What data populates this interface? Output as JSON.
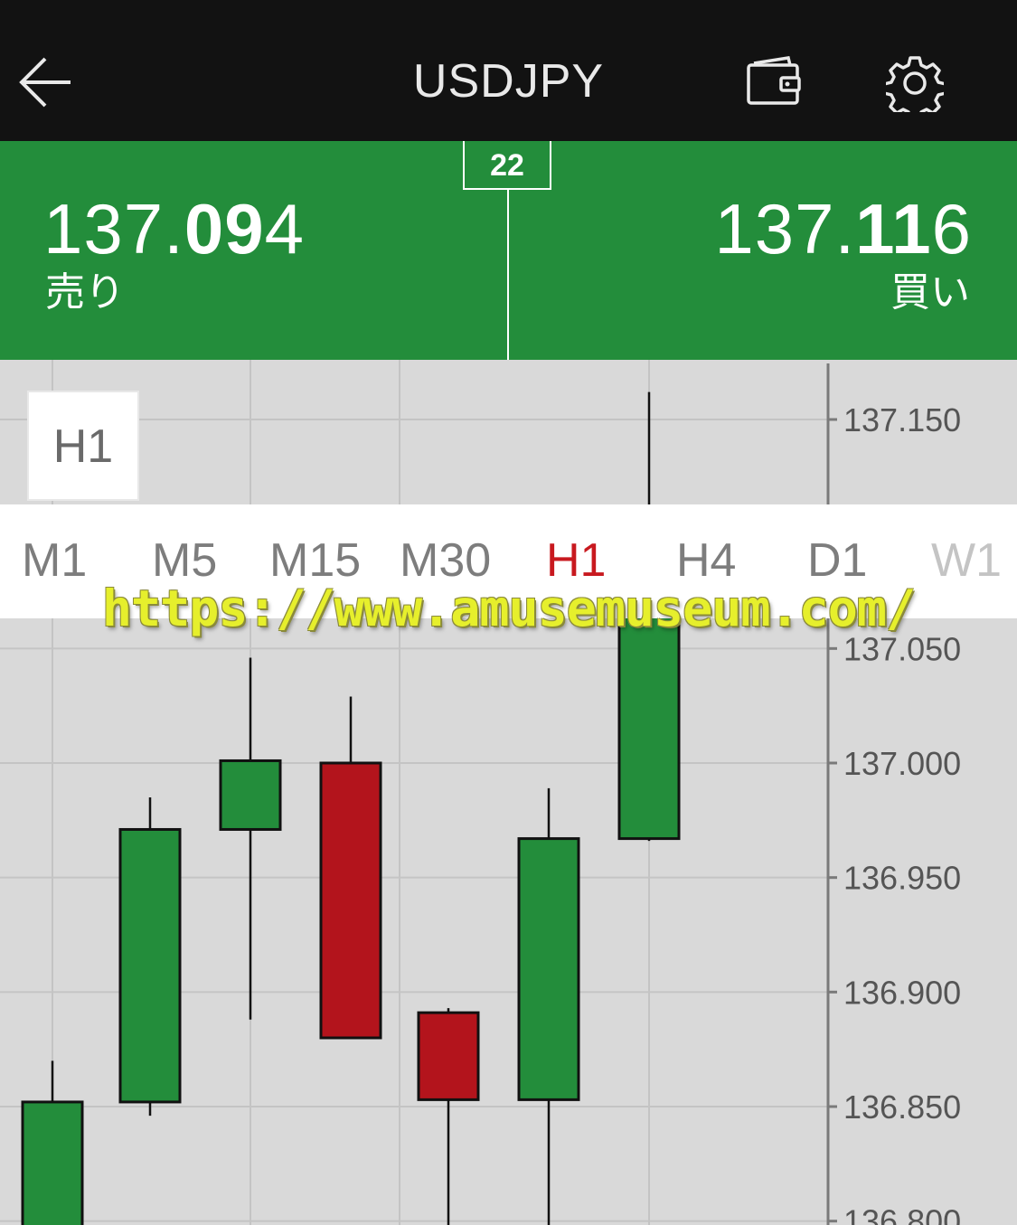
{
  "header": {
    "title": "USDJPY",
    "back_icon": "arrow-left-icon",
    "wallet_icon": "wallet-icon",
    "settings_icon": "gear-icon"
  },
  "quote": {
    "spread": "22",
    "sell": {
      "price_prefix": "137.",
      "price_big": "09",
      "price_suffix": "4",
      "label": "売り"
    },
    "buy": {
      "price_prefix": "137.",
      "price_big": "11",
      "price_suffix": "6",
      "label": "買い"
    }
  },
  "colors": {
    "header_bg": "#121212",
    "quote_bg": "#238d3b",
    "bull": "#238d3b",
    "bear": "#b3141c",
    "active_timeframe": "#c8191f"
  },
  "chart": {
    "timeframe_badge": "H1",
    "price_labels": [
      "137.150",
      "137.050",
      "137.000",
      "136.950",
      "136.900",
      "136.850",
      "136.800"
    ]
  },
  "timeframes": {
    "items": [
      "M1",
      "M5",
      "M15",
      "M30",
      "H1",
      "H4",
      "D1",
      "W1"
    ],
    "active": "H1"
  },
  "watermark": "https://www.amusemuseum.com/",
  "chart_data": {
    "type": "candlestick",
    "y_axis_labels": [
      "137.150",
      "137.050",
      "137.000",
      "136.950",
      "136.900",
      "136.850",
      "136.800"
    ],
    "candles": [
      {
        "open": 136.779,
        "high": 136.87,
        "low": 136.779,
        "close": 136.852,
        "color": "bull"
      },
      {
        "open": 136.852,
        "high": 136.985,
        "low": 136.846,
        "close": 136.971,
        "color": "bull"
      },
      {
        "open": 136.971,
        "high": 137.046,
        "low": 136.888,
        "close": 137.001,
        "color": "bull"
      },
      {
        "open": 137.0,
        "high": 137.029,
        "low": 136.88,
        "close": 136.88,
        "color": "bear"
      },
      {
        "open": 136.891,
        "high": 136.893,
        "low": 136.779,
        "close": 136.853,
        "color": "bear"
      },
      {
        "open": 136.853,
        "high": 136.989,
        "low": 136.779,
        "close": 136.967,
        "color": "bull"
      },
      {
        "open": 136.967,
        "high": 137.162,
        "low": 136.966,
        "close": 137.07,
        "color": "bull"
      }
    ]
  }
}
